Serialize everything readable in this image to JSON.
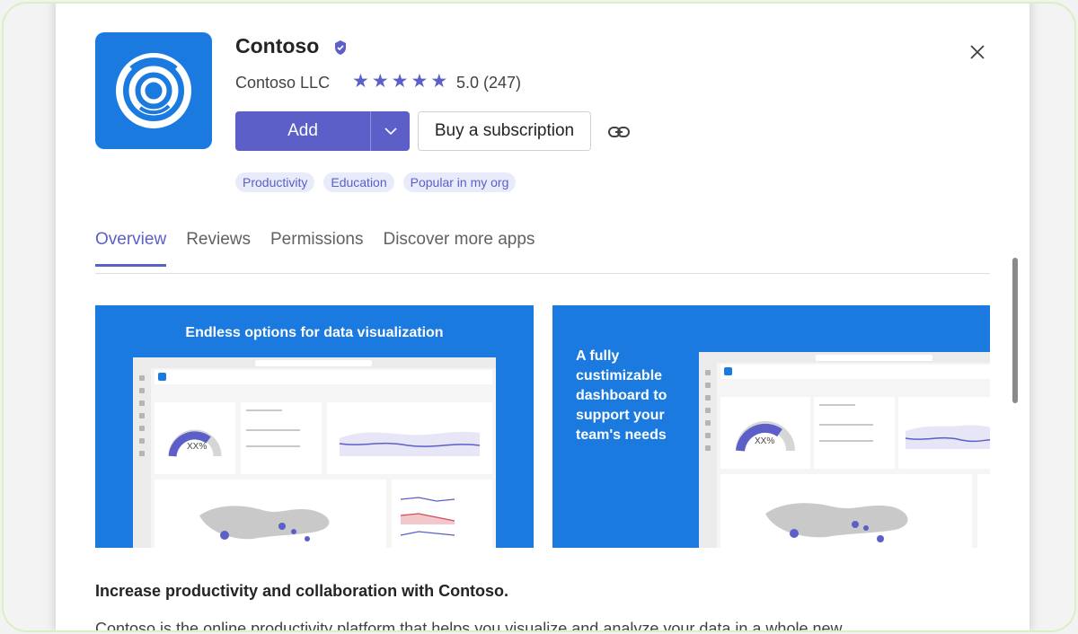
{
  "app": {
    "name": "Contoso",
    "publisher": "Contoso LLC",
    "rating_text": "5.0 (247)",
    "star_count": 5,
    "brand_color": "#1b7adf",
    "accent_color": "#5b5fc7",
    "logo_icon": "concentric-rings-icon",
    "verified_icon": "verified-badge-icon"
  },
  "actions": {
    "add_label": "Add",
    "dropdown_icon": "chevron-down-icon",
    "buy_label": "Buy a subscription",
    "link_icon": "link-icon",
    "close_icon": "close-icon"
  },
  "tags": [
    "Productivity",
    "Education",
    "Popular in my org"
  ],
  "tabs": [
    {
      "label": "Overview",
      "active": true
    },
    {
      "label": "Reviews",
      "active": false
    },
    {
      "label": "Permissions",
      "active": false
    },
    {
      "label": "Discover more apps",
      "active": false
    }
  ],
  "screenshots": [
    {
      "title": "Endless options for data visualization",
      "gauge_value": "XX%"
    },
    {
      "title": "A fully custimizable dashboard to support your team's needs",
      "gauge_value": "XX%"
    }
  ],
  "description": {
    "heading": "Increase productivity and collaboration with Contoso.",
    "body": "Contoso is the online productivity platform that helps you visualize and analyze your data in a whole new"
  }
}
